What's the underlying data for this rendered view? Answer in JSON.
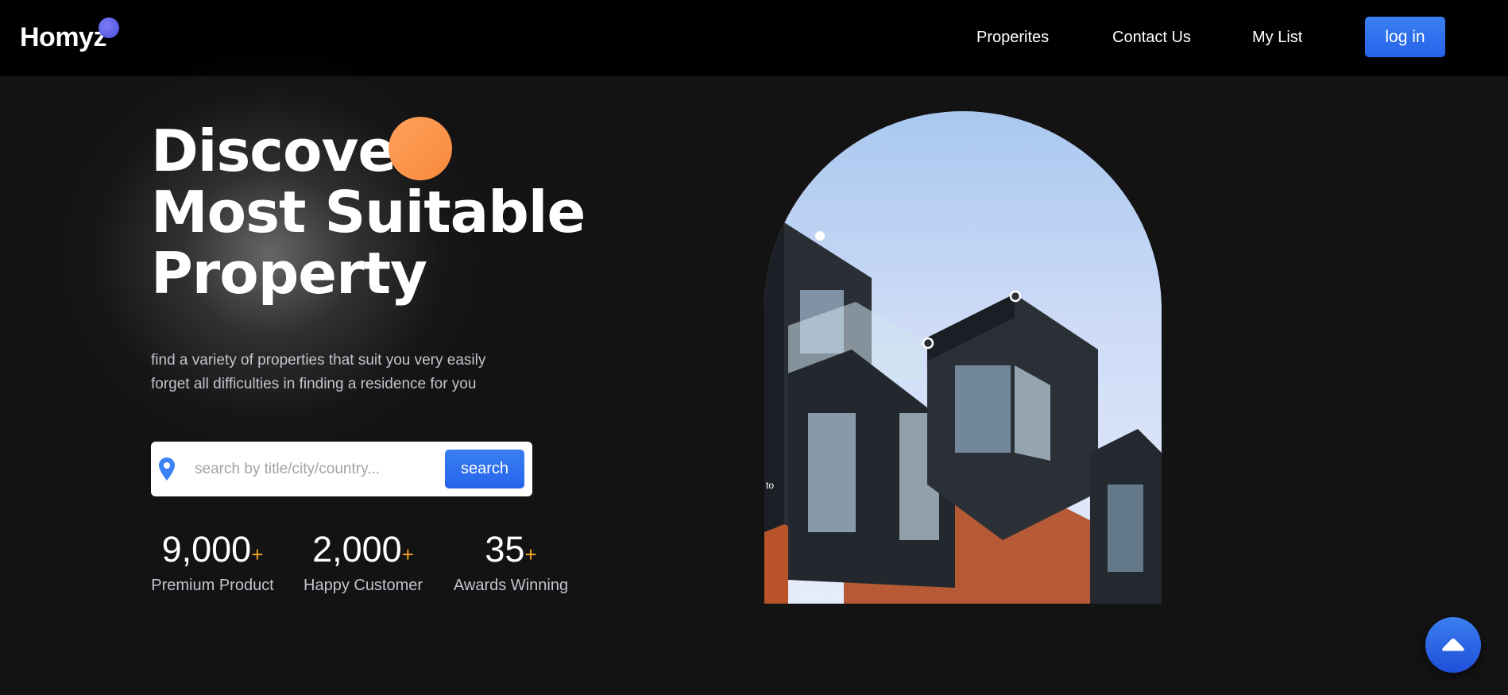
{
  "header": {
    "logo": "Homyz",
    "nav": [
      "Properites",
      "Contact Us",
      "My List"
    ],
    "login_label": "log in"
  },
  "hero": {
    "title_lines": [
      "Discover",
      "Most Suitable",
      "Property"
    ],
    "description_lines": [
      "find a variety of properties that suit you very easily",
      "forget all difficulties in finding a residence for you"
    ],
    "search": {
      "placeholder": "search by title/city/country...",
      "button_label": "search"
    },
    "stats": [
      {
        "value": "9,000",
        "suffix": "+",
        "label": "Premium Product"
      },
      {
        "value": "2,000",
        "suffix": "+",
        "label": "Happy Customer"
      },
      {
        "value": "35",
        "suffix": "+",
        "label": "Awards Winning"
      }
    ],
    "image_overlay_text": "to"
  },
  "icons": {
    "location": "map-pin-icon",
    "scroll_top": "caret-up-icon"
  },
  "colors": {
    "accent_blue": "#2563eb",
    "accent_orange": "#f88a3c",
    "plus_orange": "#f5a623",
    "background": "#131313",
    "header_bg": "#000000"
  }
}
